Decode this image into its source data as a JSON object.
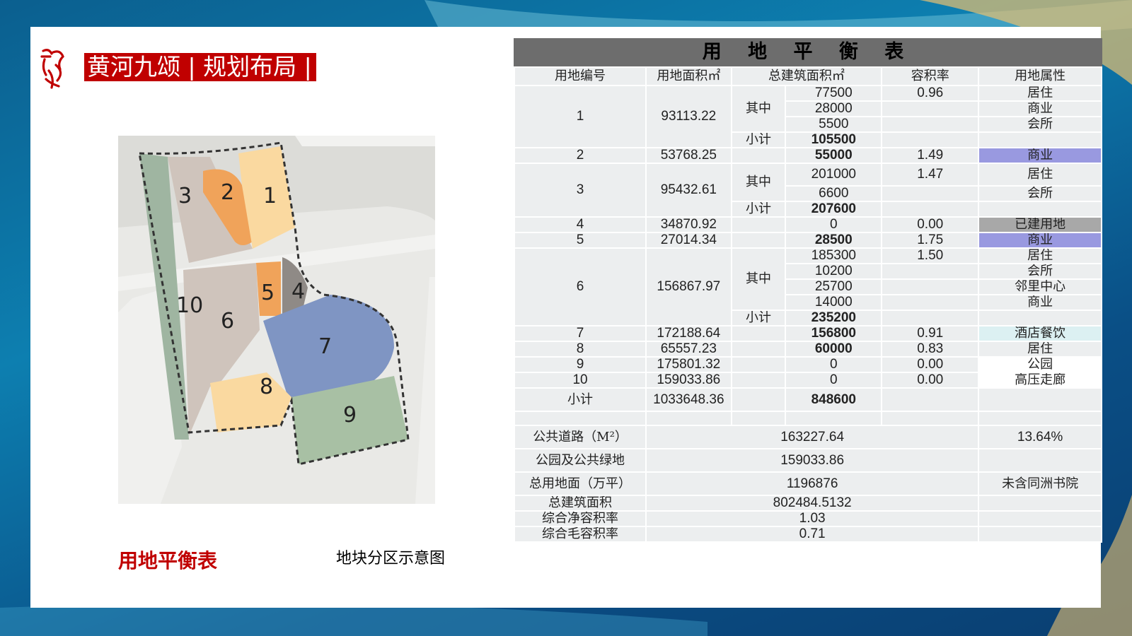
{
  "header": {
    "title": "黄河九颂 | 规划布局 |"
  },
  "captions": {
    "left": "用地平衡表",
    "right": "地块分区示意图"
  },
  "map": {
    "labels": [
      "1",
      "2",
      "3",
      "4",
      "5",
      "6",
      "7",
      "8",
      "9",
      "10"
    ]
  },
  "table": {
    "title": "用 地 平 衡 表",
    "headers": [
      "用地编号",
      "用地面积㎡",
      "总建筑面积㎡",
      "容积率",
      "用地属性"
    ],
    "sub_qizhong": "其中",
    "sub_xiaoji": "小计",
    "rows": {
      "p1": {
        "id": "1",
        "area": "93113.22",
        "b": [
          "77500",
          "28000",
          "5500"
        ],
        "sum": "105500",
        "far": "0.96",
        "use": [
          "居住",
          "商业",
          "会所"
        ]
      },
      "p2": {
        "id": "2",
        "area": "53768.25",
        "sum": "55000",
        "far": "1.49",
        "use": "商业"
      },
      "p3": {
        "id": "3",
        "area": "95432.61",
        "b": [
          "201000",
          "6600"
        ],
        "sum": "207600",
        "far": "1.47",
        "use": [
          "居住",
          "会所"
        ]
      },
      "p4": {
        "id": "4",
        "area": "34870.92",
        "sum": "0",
        "far": "0.00",
        "use": "已建用地"
      },
      "p5": {
        "id": "5",
        "area": "27014.34",
        "sum": "28500",
        "far": "1.75",
        "use": "商业"
      },
      "p6": {
        "id": "6",
        "area": "156867.97",
        "b": [
          "185300",
          "10200",
          "25700",
          "14000"
        ],
        "sum": "235200",
        "far": "1.50",
        "use": [
          "居住",
          "会所",
          "邻里中心",
          "商业"
        ]
      },
      "p7": {
        "id": "7",
        "area": "172188.64",
        "sum": "156800",
        "far": "0.91",
        "use": "酒店餐饮"
      },
      "p8": {
        "id": "8",
        "area": "65557.23",
        "sum": "60000",
        "far": "0.83",
        "use": "居住"
      },
      "p9": {
        "id": "9",
        "area": "175801.32",
        "sum": "0",
        "far": "0.00",
        "use": "公园"
      },
      "p10": {
        "id": "10",
        "area": "159033.86",
        "sum": "0",
        "far": "0.00",
        "use": "高压走廊"
      }
    },
    "subtotal": {
      "label": "小计",
      "area": "1033648.36",
      "sum": "848600"
    },
    "summary": {
      "road": {
        "label": "公共道路（M²）",
        "value": "163227.64",
        "ratio": "13.64%"
      },
      "park": {
        "label": "公园及公共绿地",
        "value": "159033.86"
      },
      "total_land": {
        "label": "总用地面（万平）",
        "value": "1196876",
        "note": "未含同洲书院"
      },
      "total_build": {
        "label": "总建筑面积",
        "value": "802484.5132"
      },
      "net_far": {
        "label": "综合净容积率",
        "value": "1.03"
      },
      "gross_far": {
        "label": "综合毛容积率",
        "value": "0.71"
      }
    }
  }
}
